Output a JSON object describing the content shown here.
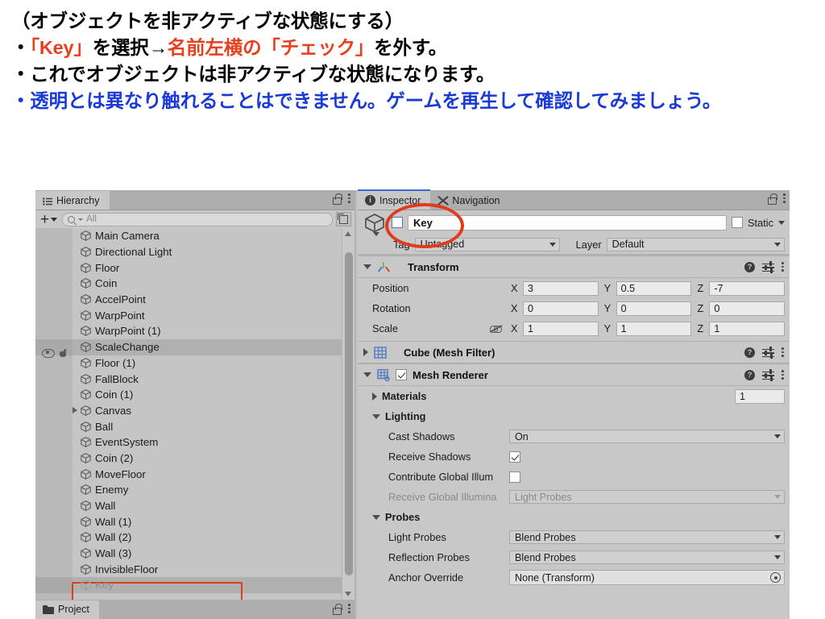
{
  "slide": {
    "lines": [
      {
        "id": "l1",
        "segments": [
          {
            "text": "（オブジェクトを非アクティブな状態にする）",
            "color": "black"
          }
        ]
      },
      {
        "id": "l2",
        "segments": [
          {
            "text": "・",
            "color": "black"
          },
          {
            "text": "「Key」",
            "color": "red"
          },
          {
            "text": "を選択→",
            "color": "black"
          },
          {
            "text": "名前左横の「チェック」",
            "color": "red"
          },
          {
            "text": "を外す。",
            "color": "black"
          }
        ]
      },
      {
        "id": "l3",
        "segments": [
          {
            "text": "・これでオブジェクトは非アクティブな状態になります。",
            "color": "black"
          }
        ]
      },
      {
        "id": "l4",
        "segments": [
          {
            "text": "・透明とは異なり触れることはできません。ゲームを再生して確認してみましょう。",
            "color": "blue"
          }
        ]
      }
    ],
    "colors": {
      "red": "#e8401f",
      "blue": "#1a3ad6",
      "black": "#000000"
    }
  },
  "hierarchy": {
    "tab_label": "Hierarchy",
    "toolbar": {
      "add_label": "+",
      "search_placeholder": "All"
    },
    "items": [
      {
        "name": "Main Camera",
        "expandable": false,
        "selected": false,
        "dim": false,
        "hovered": false
      },
      {
        "name": "Directional Light",
        "expandable": false,
        "selected": false,
        "dim": false,
        "hovered": false
      },
      {
        "name": "Floor",
        "expandable": false,
        "selected": false,
        "dim": false,
        "hovered": false
      },
      {
        "name": "Coin",
        "expandable": false,
        "selected": false,
        "dim": false,
        "hovered": false
      },
      {
        "name": "AccelPoint",
        "expandable": false,
        "selected": false,
        "dim": false,
        "hovered": false
      },
      {
        "name": "WarpPoint",
        "expandable": false,
        "selected": false,
        "dim": false,
        "hovered": false
      },
      {
        "name": "WarpPoint (1)",
        "expandable": false,
        "selected": false,
        "dim": false,
        "hovered": false
      },
      {
        "name": "ScaleChange",
        "expandable": false,
        "selected": false,
        "dim": false,
        "hovered": true
      },
      {
        "name": "Floor (1)",
        "expandable": false,
        "selected": false,
        "dim": false,
        "hovered": false
      },
      {
        "name": "FallBlock",
        "expandable": false,
        "selected": false,
        "dim": false,
        "hovered": false
      },
      {
        "name": "Coin (1)",
        "expandable": false,
        "selected": false,
        "dim": false,
        "hovered": false
      },
      {
        "name": "Canvas",
        "expandable": true,
        "selected": false,
        "dim": false,
        "hovered": false
      },
      {
        "name": "Ball",
        "expandable": false,
        "selected": false,
        "dim": false,
        "hovered": false
      },
      {
        "name": "EventSystem",
        "expandable": false,
        "selected": false,
        "dim": false,
        "hovered": false
      },
      {
        "name": "Coin (2)",
        "expandable": false,
        "selected": false,
        "dim": false,
        "hovered": false
      },
      {
        "name": "MoveFloor",
        "expandable": false,
        "selected": false,
        "dim": false,
        "hovered": false
      },
      {
        "name": "Enemy",
        "expandable": false,
        "selected": false,
        "dim": false,
        "hovered": false
      },
      {
        "name": "Wall",
        "expandable": false,
        "selected": false,
        "dim": false,
        "hovered": false
      },
      {
        "name": "Wall (1)",
        "expandable": false,
        "selected": false,
        "dim": false,
        "hovered": false
      },
      {
        "name": "Wall (2)",
        "expandable": false,
        "selected": false,
        "dim": false,
        "hovered": false
      },
      {
        "name": "Wall (3)",
        "expandable": false,
        "selected": false,
        "dim": false,
        "hovered": false
      },
      {
        "name": "InvisibleFloor",
        "expandable": false,
        "selected": false,
        "dim": false,
        "hovered": false
      },
      {
        "name": "Key",
        "expandable": false,
        "selected": true,
        "dim": true,
        "hovered": false
      }
    ]
  },
  "project": {
    "tab_label": "Project"
  },
  "inspector": {
    "tabs": [
      {
        "label": "Inspector",
        "active": true
      },
      {
        "label": "Navigation",
        "active": false
      }
    ],
    "object": {
      "active_checked": false,
      "name": "Key",
      "static_label": "Static",
      "static_checked": false,
      "tag_label": "Tag",
      "tag_value": "Untagged",
      "layer_label": "Layer",
      "layer_value": "Default"
    },
    "transform": {
      "title": "Transform",
      "expanded": true,
      "rows": [
        {
          "label": "Position",
          "x": "3",
          "y": "0.5",
          "z": "-7",
          "lock": false
        },
        {
          "label": "Rotation",
          "x": "0",
          "y": "0",
          "z": "0",
          "lock": false
        },
        {
          "label": "Scale",
          "x": "1",
          "y": "1",
          "z": "1",
          "lock": true
        }
      ],
      "axis_labels": {
        "x": "X",
        "y": "Y",
        "z": "Z"
      }
    },
    "mesh_filter": {
      "title": "Cube (Mesh Filter)",
      "expanded": false
    },
    "mesh_renderer": {
      "title": "Mesh Renderer",
      "expanded": true,
      "enabled": true,
      "materials": {
        "label": "Materials",
        "expanded": false,
        "count": "1"
      },
      "lighting": {
        "label": "Lighting",
        "expanded": true,
        "cast_shadows": {
          "label": "Cast Shadows",
          "value": "On"
        },
        "receive_shadows": {
          "label": "Receive Shadows",
          "checked": true
        },
        "contribute_gi": {
          "label": "Contribute Global Illum",
          "checked": false
        },
        "receive_gi": {
          "label": "Receive Global Illumina",
          "value": "Light Probes",
          "disabled": true
        }
      },
      "probes": {
        "label": "Probes",
        "expanded": true,
        "light_probes": {
          "label": "Light Probes",
          "value": "Blend Probes"
        },
        "reflection_probes": {
          "label": "Reflection Probes",
          "value": "Blend Probes"
        },
        "anchor_override": {
          "label": "Anchor Override",
          "value": "None (Transform)"
        }
      }
    }
  },
  "annotations": {
    "accent_color": "#e03b1a",
    "ellipse_target": "active-checkbox-and-name",
    "box_target": "hierarchy-key-row"
  }
}
